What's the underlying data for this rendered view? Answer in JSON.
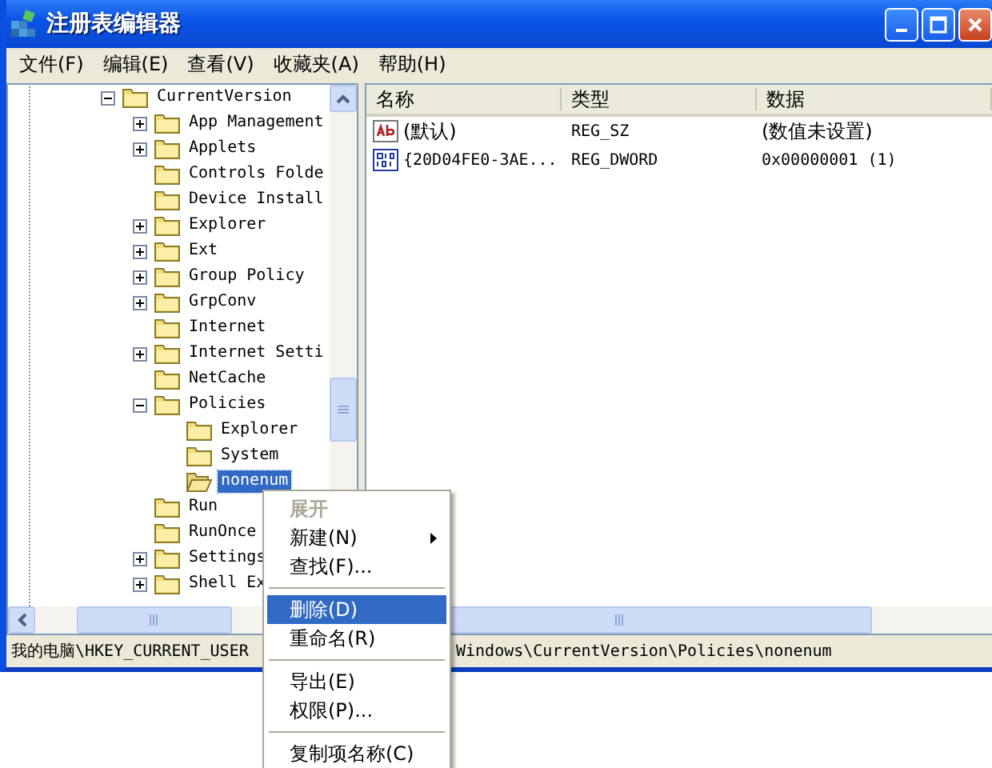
{
  "window": {
    "title": "注册表编辑器"
  },
  "menubar": [
    "文件(F)",
    "编辑(E)",
    "查看(V)",
    "收藏夹(A)",
    "帮助(H)"
  ],
  "tree": [
    {
      "label": "CurrentVersion",
      "has_children": true,
      "expanded": true,
      "selected": false,
      "children": [
        {
          "label": "App Management",
          "has_children": true,
          "expanded": false,
          "selected": false
        },
        {
          "label": "Applets",
          "has_children": true,
          "expanded": false,
          "selected": false
        },
        {
          "label": "Controls Folde",
          "has_children": false,
          "selected": false
        },
        {
          "label": "Device Install",
          "has_children": false,
          "selected": false
        },
        {
          "label": "Explorer",
          "has_children": true,
          "expanded": false,
          "selected": false
        },
        {
          "label": "Ext",
          "has_children": true,
          "expanded": false,
          "selected": false
        },
        {
          "label": "Group Policy",
          "has_children": true,
          "expanded": false,
          "selected": false
        },
        {
          "label": "GrpConv",
          "has_children": true,
          "expanded": false,
          "selected": false
        },
        {
          "label": "Internet",
          "has_children": false,
          "selected": false
        },
        {
          "label": "Internet Setti",
          "has_children": true,
          "expanded": false,
          "selected": false
        },
        {
          "label": "NetCache",
          "has_children": false,
          "selected": false
        },
        {
          "label": "Policies",
          "has_children": true,
          "expanded": true,
          "selected": false,
          "children": [
            {
              "label": "Explorer",
              "has_children": false,
              "selected": false
            },
            {
              "label": "System",
              "has_children": false,
              "selected": false
            },
            {
              "label": "nonenum",
              "has_children": false,
              "selected": true
            }
          ]
        },
        {
          "label": "Run",
          "has_children": false,
          "selected": false
        },
        {
          "label": "RunOnce",
          "has_children": false,
          "selected": false
        },
        {
          "label": "Settings",
          "has_children": true,
          "expanded": false,
          "selected": false
        },
        {
          "label": "Shell Ex",
          "has_children": true,
          "expanded": false,
          "selected": false
        }
      ]
    }
  ],
  "list": {
    "columns": [
      "名称",
      "类型",
      "数据"
    ],
    "rows": [
      {
        "kind": "string",
        "name": "(默认)",
        "type": "REG_SZ",
        "data": "(数值未设置)"
      },
      {
        "kind": "dword",
        "name": "{20D04FE0-3AE...",
        "type": "REG_DWORD",
        "data": "0x00000001 (1)"
      }
    ]
  },
  "status_bar": [
    "我的电脑\\HKEY_CURRENT_USER",
    "Windows\\CurrentVersion\\Policies\\nonenum"
  ],
  "context_menu": [
    {
      "kind": "item",
      "label": "展开",
      "default": true,
      "disabled": true,
      "submenu": false,
      "selected": false
    },
    {
      "kind": "item",
      "label": "新建(N)",
      "default": false,
      "disabled": false,
      "submenu": true,
      "selected": false
    },
    {
      "kind": "item",
      "label": "查找(F)...",
      "default": false,
      "disabled": false,
      "submenu": false,
      "selected": false
    },
    {
      "kind": "separator"
    },
    {
      "kind": "item",
      "label": "删除(D)",
      "default": false,
      "disabled": false,
      "submenu": false,
      "selected": true
    },
    {
      "kind": "item",
      "label": "重命名(R)",
      "default": false,
      "disabled": false,
      "submenu": false,
      "selected": false
    },
    {
      "kind": "separator"
    },
    {
      "kind": "item",
      "label": "导出(E)",
      "default": false,
      "disabled": false,
      "submenu": false,
      "selected": false
    },
    {
      "kind": "item",
      "label": "权限(P)...",
      "default": false,
      "disabled": false,
      "submenu": false,
      "selected": false
    },
    {
      "kind": "separator"
    },
    {
      "kind": "item",
      "label": "复制项名称(C)",
      "default": false,
      "disabled": false,
      "submenu": false,
      "selected": false
    }
  ]
}
